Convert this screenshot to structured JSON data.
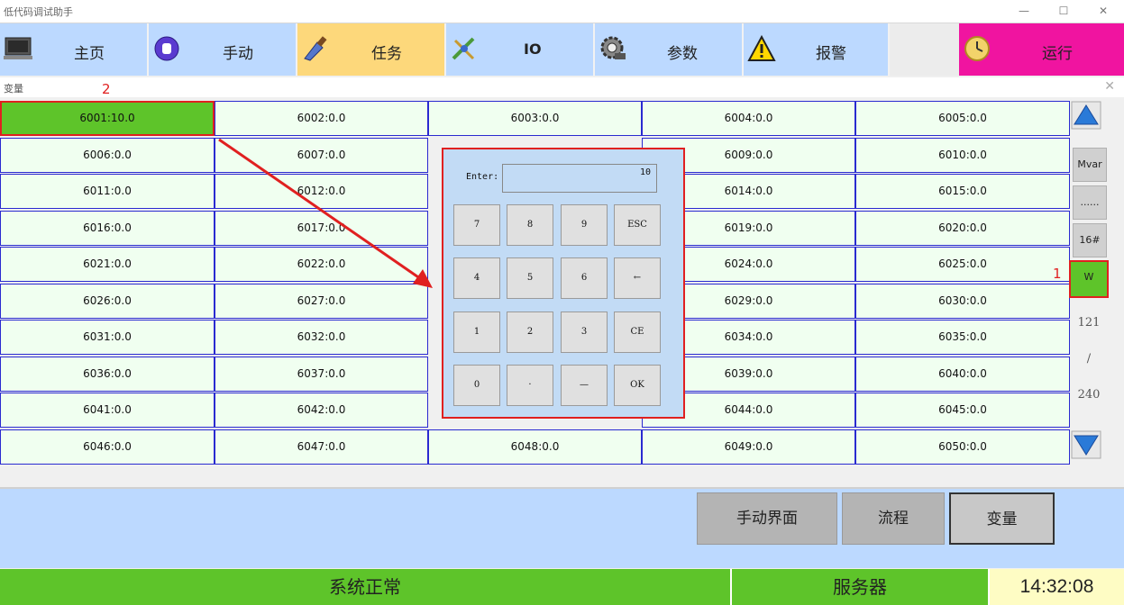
{
  "window": {
    "title": "低代码调试助手",
    "min": "—",
    "max": "☐",
    "close": "✕"
  },
  "nav": [
    {
      "label": "主页",
      "icon": "monitor-icon"
    },
    {
      "label": "手动",
      "icon": "hand-icon"
    },
    {
      "label": "任务",
      "icon": "brush-icon",
      "active": true
    },
    {
      "label": "IO",
      "icon": "plug-icon"
    },
    {
      "label": "参数",
      "icon": "gear-icon"
    },
    {
      "label": "报警",
      "icon": "warning-icon"
    },
    {
      "label": "",
      "icon": ""
    },
    {
      "label": "运行",
      "icon": "clock-icon"
    }
  ],
  "panel": {
    "title": "变量",
    "close": "✕",
    "annotation_2": "2",
    "annotation_1": "1"
  },
  "grid": [
    [
      "6001:10.0",
      "6002:0.0",
      "6003:0.0",
      "6004:0.0",
      "6005:0.0"
    ],
    [
      "6006:0.0",
      "6007:0.0",
      "",
      "6009:0.0",
      "6010:0.0"
    ],
    [
      "6011:0.0",
      "6012:0.0",
      "",
      "6014:0.0",
      "6015:0.0"
    ],
    [
      "6016:0.0",
      "6017:0.0",
      "",
      "6019:0.0",
      "6020:0.0"
    ],
    [
      "6021:0.0",
      "6022:0.0",
      "",
      "6024:0.0",
      "6025:0.0"
    ],
    [
      "6026:0.0",
      "6027:0.0",
      "",
      "6029:0.0",
      "6030:0.0"
    ],
    [
      "6031:0.0",
      "6032:0.0",
      "",
      "6034:0.0",
      "6035:0.0"
    ],
    [
      "6036:0.0",
      "6037:0.0",
      "",
      "6039:0.0",
      "6040:0.0"
    ],
    [
      "6041:0.0",
      "6042:0.0",
      "",
      "6044:0.0",
      "6045:0.0"
    ],
    [
      "6046:0.0",
      "6047:0.0",
      "6048:0.0",
      "6049:0.0",
      "6050:0.0"
    ]
  ],
  "side": {
    "mvar": "Mvar",
    "dots": "......",
    "hex": "16#",
    "w": "W",
    "page_current": "121",
    "page_sep": "/",
    "page_total": "240"
  },
  "keypad": {
    "label": "Enter:",
    "value": "10",
    "keys": [
      [
        "7",
        "8",
        "9",
        "ESC"
      ],
      [
        "4",
        "5",
        "6",
        "←"
      ],
      [
        "1",
        "2",
        "3",
        "CE"
      ],
      [
        "0",
        "·",
        "—",
        "OK"
      ]
    ]
  },
  "bottom": {
    "manual": "手动界面",
    "flow": "流程",
    "vars": "变量"
  },
  "status": {
    "system": "系统正常",
    "server": "服务器",
    "time": "14:32:08"
  },
  "colors": {
    "nav_bg": "#bcd9ff",
    "nav_active": "#fdd87b",
    "run_bg": "#f014a0",
    "cell_bg": "#f0fff0",
    "selected": "#5ec42a",
    "annotation": "#e02020"
  }
}
